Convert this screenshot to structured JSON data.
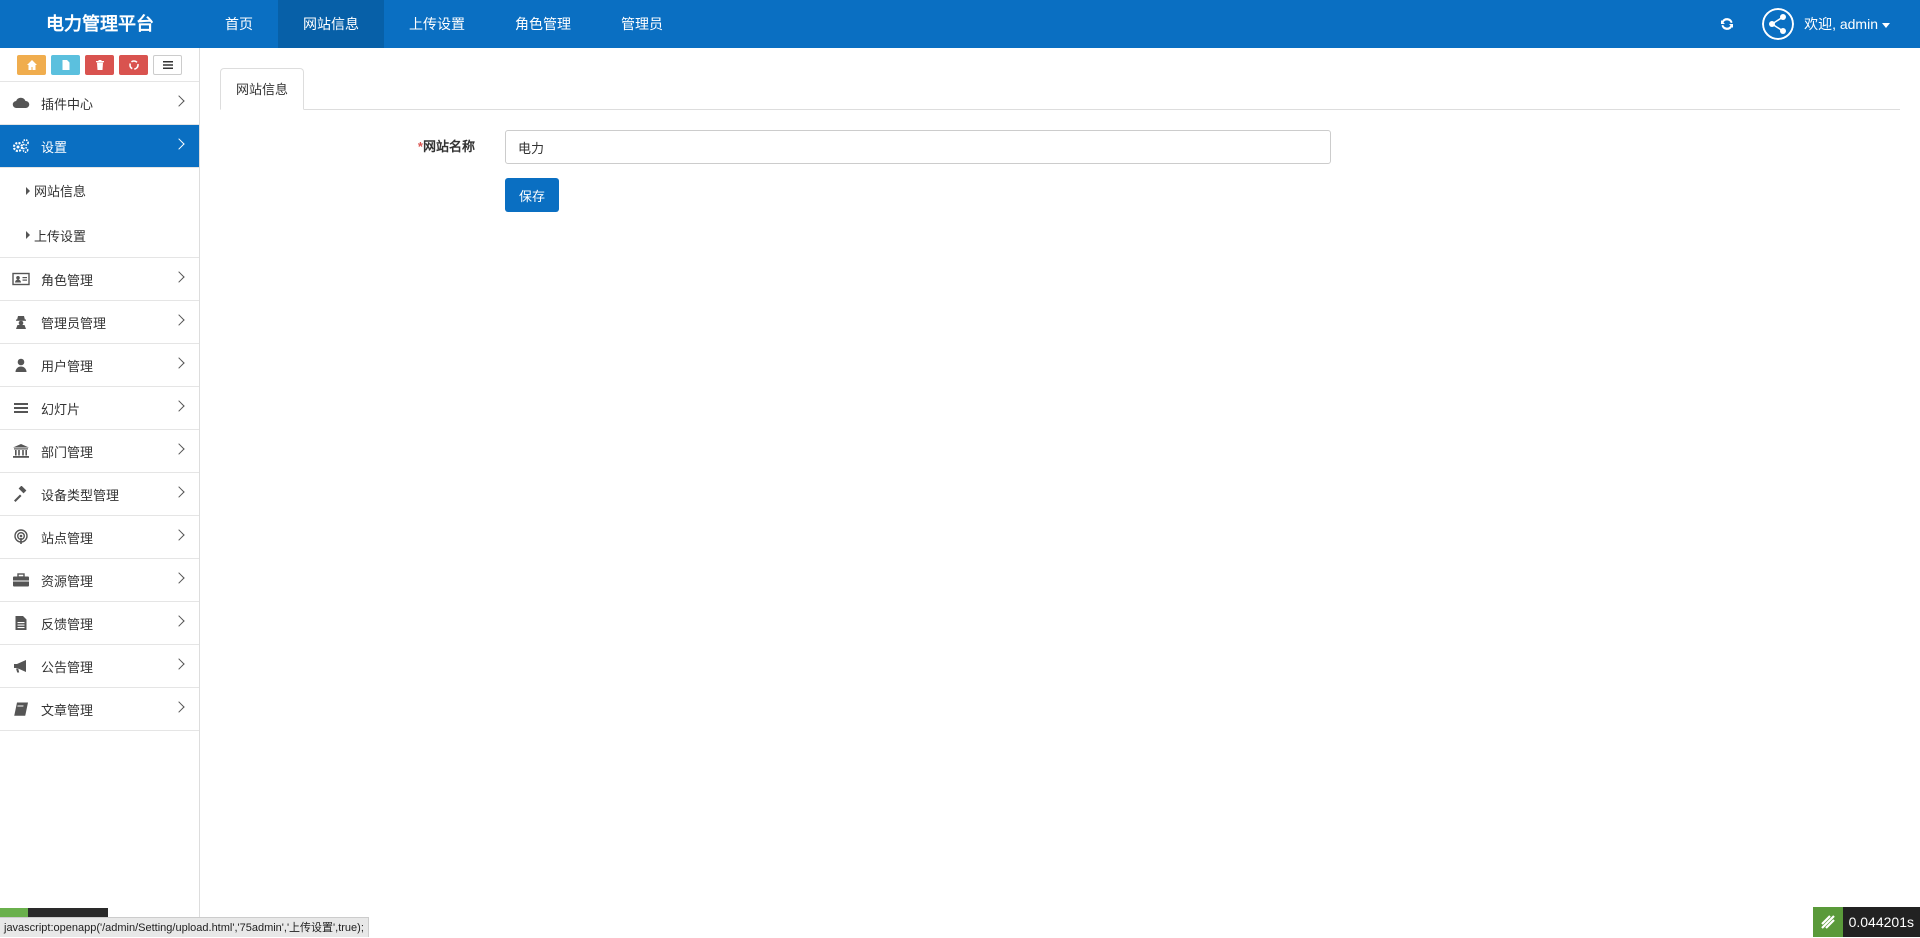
{
  "header": {
    "brand": "电力管理平台",
    "nav": [
      "首页",
      "网站信息",
      "上传设置",
      "角色管理",
      "管理员"
    ],
    "welcome": "欢迎, admin"
  },
  "sidebar": {
    "shortcuts": [
      "home-icon",
      "file-icon",
      "trash-icon",
      "recycle-icon",
      "list-icon"
    ],
    "items": [
      {
        "label": "插件中心",
        "icon": "cloud-icon"
      },
      {
        "label": "设置",
        "icon": "gears-icon"
      },
      {
        "label": "角色管理",
        "icon": "id-card-icon"
      },
      {
        "label": "管理员管理",
        "icon": "user-secret-icon"
      },
      {
        "label": "用户管理",
        "icon": "user-icon"
      },
      {
        "label": "幻灯片",
        "icon": "bars-icon"
      },
      {
        "label": "部门管理",
        "icon": "bank-icon"
      },
      {
        "label": "设备类型管理",
        "icon": "gavel-icon"
      },
      {
        "label": "站点管理",
        "icon": "podcast-icon"
      },
      {
        "label": "资源管理",
        "icon": "briefcase-icon"
      },
      {
        "label": "反馈管理",
        "icon": "file-text-icon"
      },
      {
        "label": "公告管理",
        "icon": "bullhorn-icon"
      },
      {
        "label": "文章管理",
        "icon": "book-icon"
      }
    ],
    "subitems": [
      "网站信息",
      "上传设置"
    ]
  },
  "main": {
    "tab": "网站信息",
    "required_mark": "*",
    "field_label": "网站名称",
    "field_value": "电力",
    "save_label": "保存"
  },
  "status": {
    "url": "javascript:openapp('/admin/Setting/upload.html','75admin','上传设置',true);",
    "timer": "0.044201s"
  },
  "colors": {
    "primary": "#0a6fc2",
    "primary_dark": "#0760a8",
    "warning": "#f0ad4e",
    "info": "#5bc0de",
    "danger": "#d9534f"
  }
}
